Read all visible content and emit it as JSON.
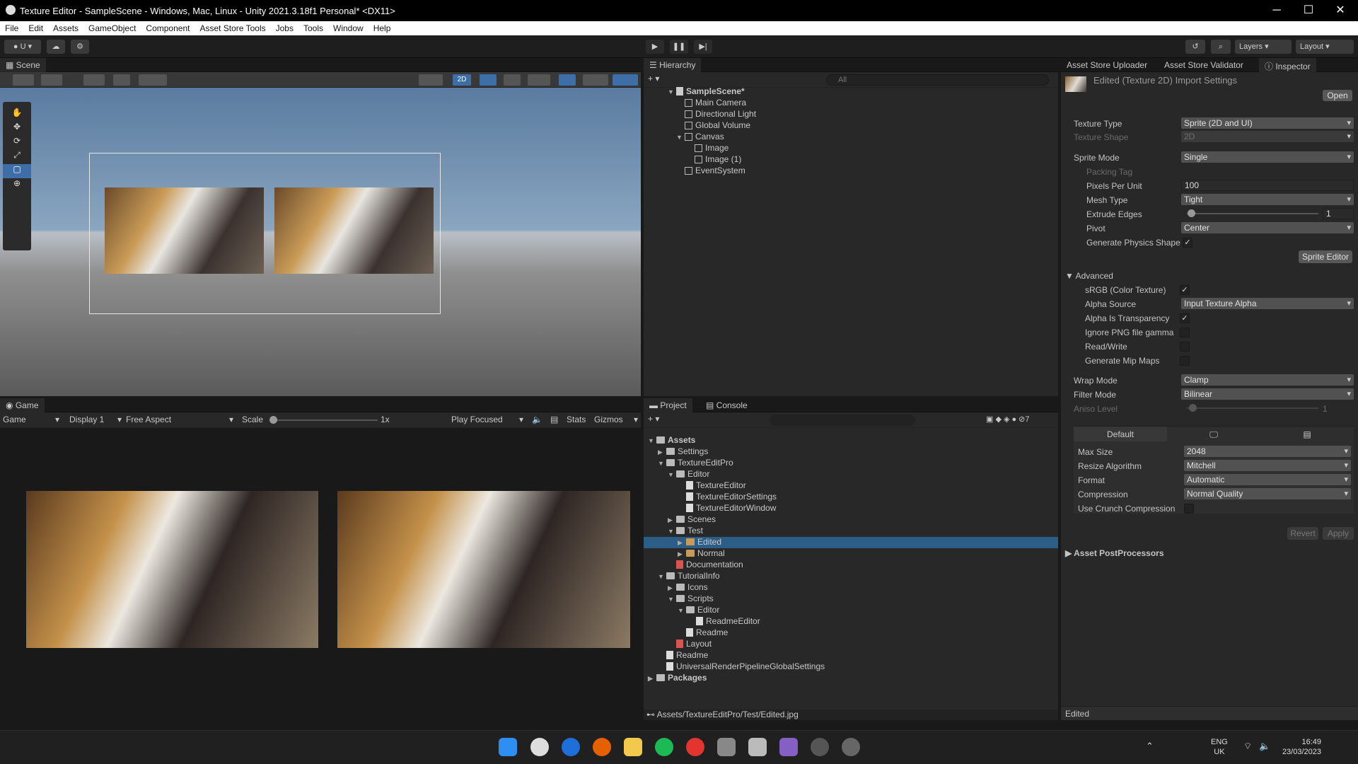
{
  "window": {
    "title": "Texture Editor - SampleScene - Windows, Mac, Linux - Unity 2021.3.18f1 Personal* <DX11>"
  },
  "menu": [
    "File",
    "Edit",
    "Assets",
    "GameObject",
    "Component",
    "Asset Store Tools",
    "Jobs",
    "Tools",
    "Window",
    "Help"
  ],
  "toolbar": {
    "account": "U",
    "layers": "Layers",
    "layout": "Layout"
  },
  "scene": {
    "tab": "Scene",
    "mode2d": "2D"
  },
  "hierarchy": {
    "tab": "Hierarchy",
    "search_placeholder": "All",
    "items": [
      "SampleScene*",
      "Main Camera",
      "Directional Light",
      "Global Volume",
      "Canvas",
      "Image",
      "Image (1)",
      "EventSystem"
    ]
  },
  "game": {
    "tab": "Game",
    "view": "Game",
    "display": "Display 1",
    "aspect": "Free Aspect",
    "scale_label": "Scale",
    "scale_value": "1x",
    "play_mode": "Play Focused",
    "stats": "Stats",
    "gizmos": "Gizmos"
  },
  "project": {
    "tab": "Project",
    "console_tab": "Console",
    "hidden_count": "7",
    "items": [
      "Assets",
      "Settings",
      "TextureEditPro",
      "Editor",
      "TextureEditor",
      "TextureEditorSettings",
      "TextureEditorWindow",
      "Scenes",
      "Test",
      "Edited",
      "Normal",
      "Documentation",
      "TutorialInfo",
      "Icons",
      "Scripts",
      "Editor",
      "ReadmeEditor",
      "Readme",
      "Layout",
      "Readme",
      "UniversalRenderPipelineGlobalSettings",
      "Packages"
    ],
    "path": "Assets/TextureEditPro/Test/Edited.jpg"
  },
  "inspector": {
    "tabs": [
      "Asset Store Uploader",
      "Asset Store Validator",
      "Inspector"
    ],
    "header": "Edited (Texture 2D) Import Settings",
    "open_btn": "Open",
    "texture_type_label": "Texture Type",
    "texture_type": "Sprite (2D and UI)",
    "texture_shape_label": "Texture Shape",
    "texture_shape": "2D",
    "sprite_mode_label": "Sprite Mode",
    "sprite_mode": "Single",
    "packing_tag_label": "Packing Tag",
    "ppu_label": "Pixels Per Unit",
    "ppu": "100",
    "mesh_type_label": "Mesh Type",
    "mesh_type": "Tight",
    "extrude_label": "Extrude Edges",
    "extrude": "1",
    "extrude_fraction": 0.03,
    "pivot_label": "Pivot",
    "pivot": "Center",
    "physics_label": "Generate Physics Shape",
    "sprite_editor_btn": "Sprite Editor",
    "advanced_label": "Advanced",
    "srgb_label": "sRGB (Color Texture)",
    "alpha_source_label": "Alpha Source",
    "alpha_source": "Input Texture Alpha",
    "alpha_transp_label": "Alpha Is Transparency",
    "ignore_png_label": "Ignore PNG file gamma",
    "readwrite_label": "Read/Write",
    "mipmaps_label": "Generate Mip Maps",
    "wrap_label": "Wrap Mode",
    "wrap": "Clamp",
    "filter_label": "Filter Mode",
    "filter": "Bilinear",
    "aniso_label": "Aniso Level",
    "aniso": "1",
    "platform_default": "Default",
    "maxsize_label": "Max Size",
    "maxsize": "2048",
    "resize_label": "Resize Algorithm",
    "resize": "Mitchell",
    "format_label": "Format",
    "format": "Automatic",
    "compression_label": "Compression",
    "compression": "Normal Quality",
    "crunch_label": "Use Crunch Compression",
    "revert_btn": "Revert",
    "apply_btn": "Apply",
    "postprocessors_label": "Asset PostProcessors",
    "footer": "Edited"
  },
  "taskbar": {
    "lang1": "ENG",
    "lang2": "UK",
    "time": "16:49",
    "date": "23/03/2023"
  },
  "colors": {
    "selection": "#2c5d87",
    "panel": "#282828",
    "accent_blue": "#3d6ea8"
  }
}
